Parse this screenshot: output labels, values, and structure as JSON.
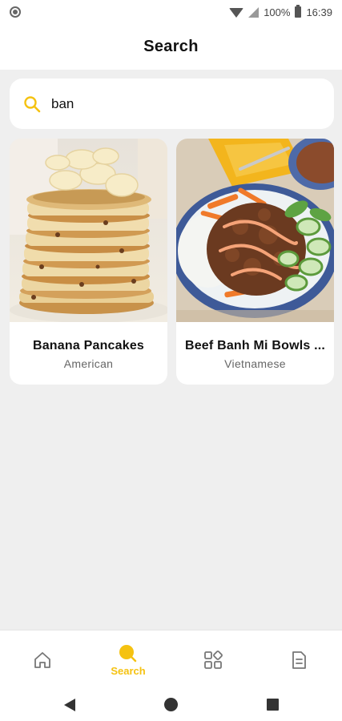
{
  "status_bar": {
    "battery": "100%",
    "time": "16:39"
  },
  "header": {
    "title": "Search"
  },
  "search": {
    "value": "ban",
    "icon": "search-icon"
  },
  "results": [
    {
      "title": "Banana Pancakes",
      "cuisine": "American",
      "image": "banana-pancakes-photo"
    },
    {
      "title": "Beef Banh Mi Bowls ...",
      "cuisine": "Vietnamese",
      "image": "beef-banh-mi-bowl-photo"
    }
  ],
  "bottom_nav": {
    "active_label": "Search",
    "items": [
      "home-icon",
      "search-icon",
      "categories-icon",
      "saved-recipes-icon"
    ]
  },
  "colors": {
    "accent": "#f5c211",
    "background": "#efefef",
    "card": "#ffffff"
  }
}
